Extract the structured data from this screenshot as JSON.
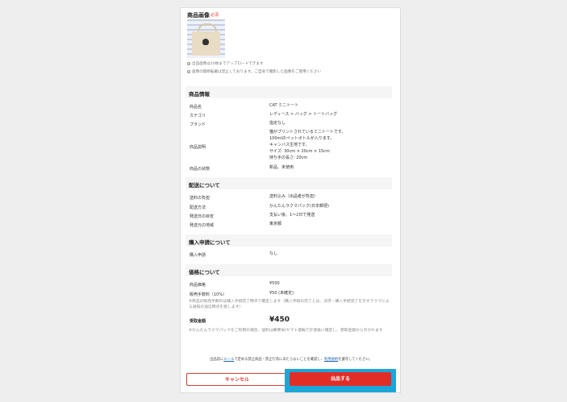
{
  "image_section": {
    "title": "商品画像",
    "required": "必須",
    "notes": [
      "出品画像は10枚までアップロードできます",
      "画像の無断転載は禁止しております。ご自身で撮影した画像をご使用ください"
    ]
  },
  "product_info": {
    "heading": "商品情報",
    "rows": [
      {
        "label": "商品名",
        "value": "CAT ミニトート"
      },
      {
        "label": "カテゴリ",
        "value": "レディース > バッグ > トートバッグ"
      },
      {
        "label": "ブランド",
        "value": "指定なし"
      },
      {
        "label": "商品説明",
        "value_lines": [
          "猫がプリントされているミニトートです。",
          "100mlのペットボトルが入ります。",
          "キャンバス生地です。",
          "サイズ: 30cm × 20cm × 15cm",
          "持ち手の長さ: 20cm"
        ]
      },
      {
        "label": "商品の状態",
        "value": "新品、未使用"
      }
    ]
  },
  "shipping": {
    "heading": "配送について",
    "rows": [
      {
        "label": "送料の負担",
        "value": "送料込み（出品者が負担）"
      },
      {
        "label": "配送方法",
        "value": "かんたんラクマパック(日本郵便)"
      },
      {
        "label": "発送日の目安",
        "value": "支払い後、1〜2日で発送"
      },
      {
        "label": "発送元の地域",
        "value": "東京都"
      }
    ]
  },
  "purchase_request": {
    "heading": "購入申請について",
    "rows": [
      {
        "label": "購入申請",
        "value": "なし"
      }
    ]
  },
  "price": {
    "heading": "価格について",
    "rows": [
      {
        "label": "商品価格",
        "value": "¥500"
      },
      {
        "label": "販売手数料（10%）",
        "value": "¥50 (未確定)"
      }
    ],
    "fee_note": "※商品の販売手数料は購入手続完了時点で確定します（購入手続の完了とは、決済・購入手続完了を示すラクマによる通知の送信時点を指します）",
    "receive_label": "受取金額",
    "receive_value": "¥450",
    "pack_note": "※かんたんラクマパックをご利用の場合、送料は郵便局/ヤマト運輸で計測後に確定し、受取金額から引かれます"
  },
  "agreement": {
    "prefix": "出品前に",
    "rules_link": "ルール",
    "middle": "で定める禁止商品・禁止行為にあたらないことを確認し、",
    "terms_link": "利用規約",
    "suffix": "を遵守してください。"
  },
  "actions": {
    "cancel_label": "キャンセル",
    "submit_label": "出品する"
  },
  "colors": {
    "accent": "#e22d27",
    "highlight": "#1ba6d9",
    "link": "#1a5fb4"
  }
}
